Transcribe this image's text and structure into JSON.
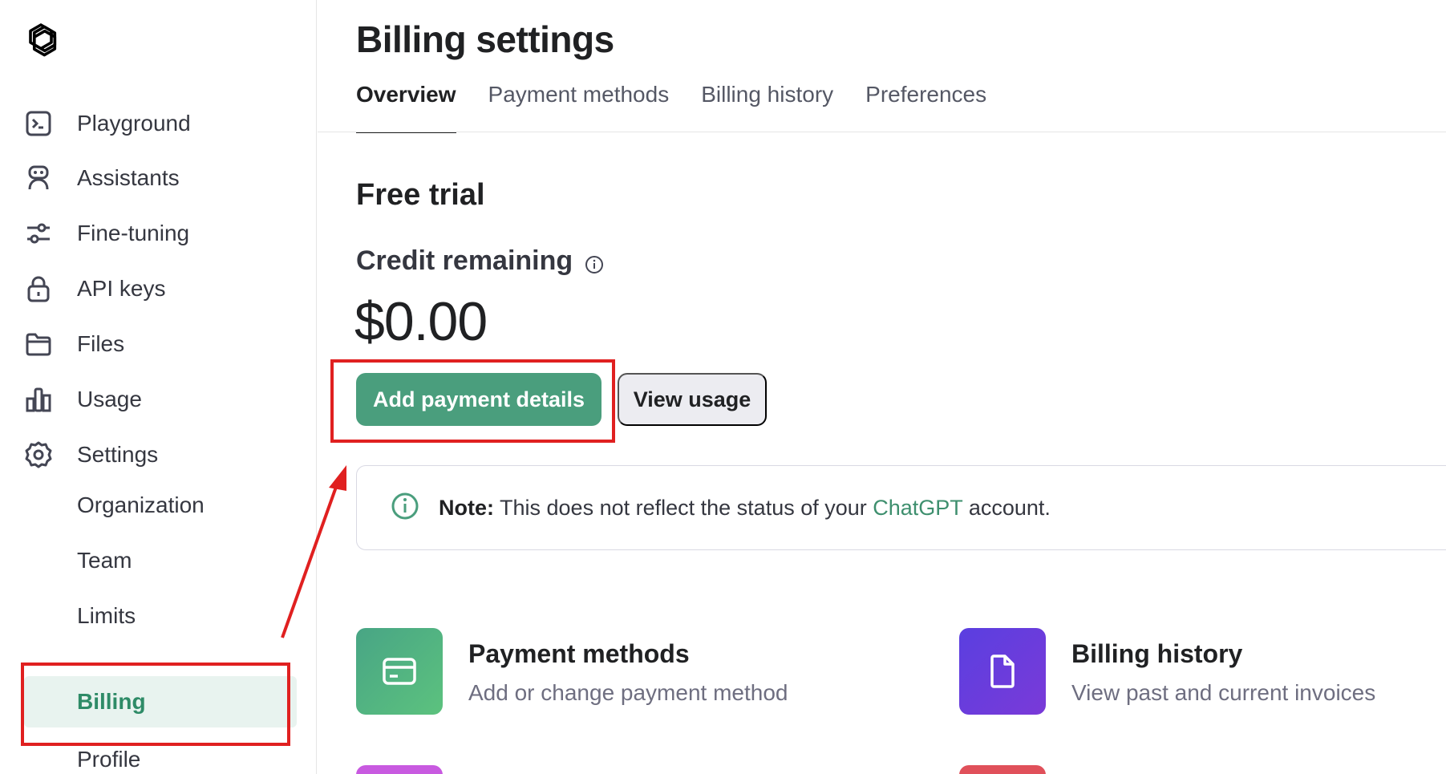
{
  "sidebar": {
    "items": [
      {
        "label": "Playground",
        "icon": "terminal-icon"
      },
      {
        "label": "Assistants",
        "icon": "robot-icon"
      },
      {
        "label": "Fine-tuning",
        "icon": "sliders-icon"
      },
      {
        "label": "API keys",
        "icon": "lock-icon"
      },
      {
        "label": "Files",
        "icon": "folder-icon"
      },
      {
        "label": "Usage",
        "icon": "bar-chart-icon"
      },
      {
        "label": "Settings",
        "icon": "gear-icon"
      }
    ],
    "sub_items": [
      {
        "label": "Organization"
      },
      {
        "label": "Team"
      },
      {
        "label": "Limits"
      },
      {
        "label": "Billing",
        "active": true
      },
      {
        "label": "Profile"
      }
    ]
  },
  "header": {
    "title": "Billing settings",
    "tabs": [
      "Overview",
      "Payment methods",
      "Billing history",
      "Preferences"
    ],
    "active_tab": "Overview"
  },
  "overview": {
    "section_title": "Free trial",
    "credit_label": "Credit remaining",
    "credit_value": "$0.00",
    "primary_button": "Add payment details",
    "secondary_button": "View usage",
    "note": {
      "bold": "Note:",
      "text_before": "This does not reflect the status of your",
      "link": "ChatGPT",
      "text_after": "account."
    }
  },
  "cards": [
    {
      "title": "Payment methods",
      "desc": "Add or change payment method",
      "color": "#52b888",
      "icon": "credit-card-icon"
    },
    {
      "title": "Billing history",
      "desc": "View past and current invoices",
      "color": "#6b3fe0",
      "icon": "document-icon"
    }
  ],
  "colors": {
    "accent_green": "#4a9e7d",
    "active_bg": "#e8f3ef",
    "annotation_red": "#e02020",
    "peek_purple": "#c85ae0",
    "peek_red": "#e0505a"
  }
}
